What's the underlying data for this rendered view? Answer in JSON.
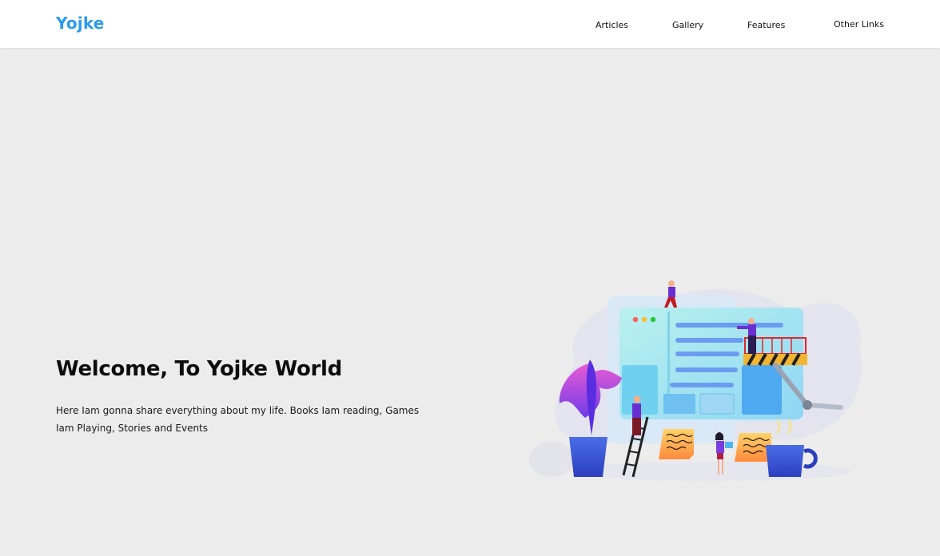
{
  "header": {
    "brand": "Yojke",
    "nav": {
      "articles": "Articles",
      "gallery": "Gallery",
      "features": "Features",
      "other_links": "Other Links"
    }
  },
  "hero": {
    "title": "Welcome, To Yojke World",
    "description": "Here Iam gonna share everything about my life. Books Iam reading, Games Iam Playing, Stories and Events"
  },
  "colors": {
    "brand": "#2b9be8",
    "background": "#ececec",
    "header": "#ffffff"
  }
}
